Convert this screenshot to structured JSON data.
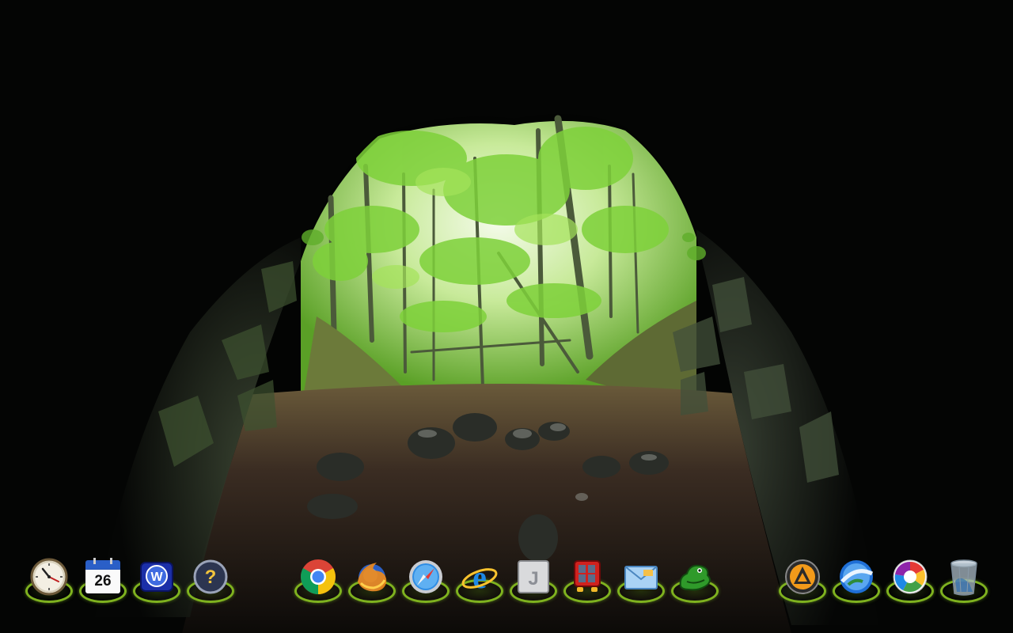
{
  "wallpaper": {
    "name": "cave-forest-wallpaper",
    "colors": {
      "cave": "#050605",
      "foliage": "#7ed13a",
      "sky": "#eef7e4",
      "floor": "#3b2a22"
    }
  },
  "dock": {
    "items": [
      {
        "name": "clock",
        "icon": "analog-clock-icon"
      },
      {
        "name": "calendar",
        "icon": "calendar-icon",
        "label": "26"
      },
      {
        "name": "wordweb",
        "icon": "wordweb-icon"
      },
      {
        "name": "help",
        "icon": "help-icon"
      },
      {
        "name": "chrome",
        "icon": "chrome-icon"
      },
      {
        "name": "firefox",
        "icon": "firefox-icon"
      },
      {
        "name": "safari",
        "icon": "safari-icon"
      },
      {
        "name": "internet-explorer",
        "icon": "ie-icon"
      },
      {
        "name": "j-app",
        "icon": "j-app-icon"
      },
      {
        "name": "tv-app",
        "icon": "retro-tv-icon"
      },
      {
        "name": "mail",
        "icon": "mail-icon"
      },
      {
        "name": "gecko-app",
        "icon": "gecko-icon"
      },
      {
        "name": "aimp",
        "icon": "aimp-icon"
      },
      {
        "name": "google-earth",
        "icon": "google-earth-icon"
      },
      {
        "name": "picasa",
        "icon": "picasa-icon"
      },
      {
        "name": "recycle-bin",
        "icon": "recycle-bin-icon"
      }
    ],
    "ring_color": "#7fb21f"
  }
}
